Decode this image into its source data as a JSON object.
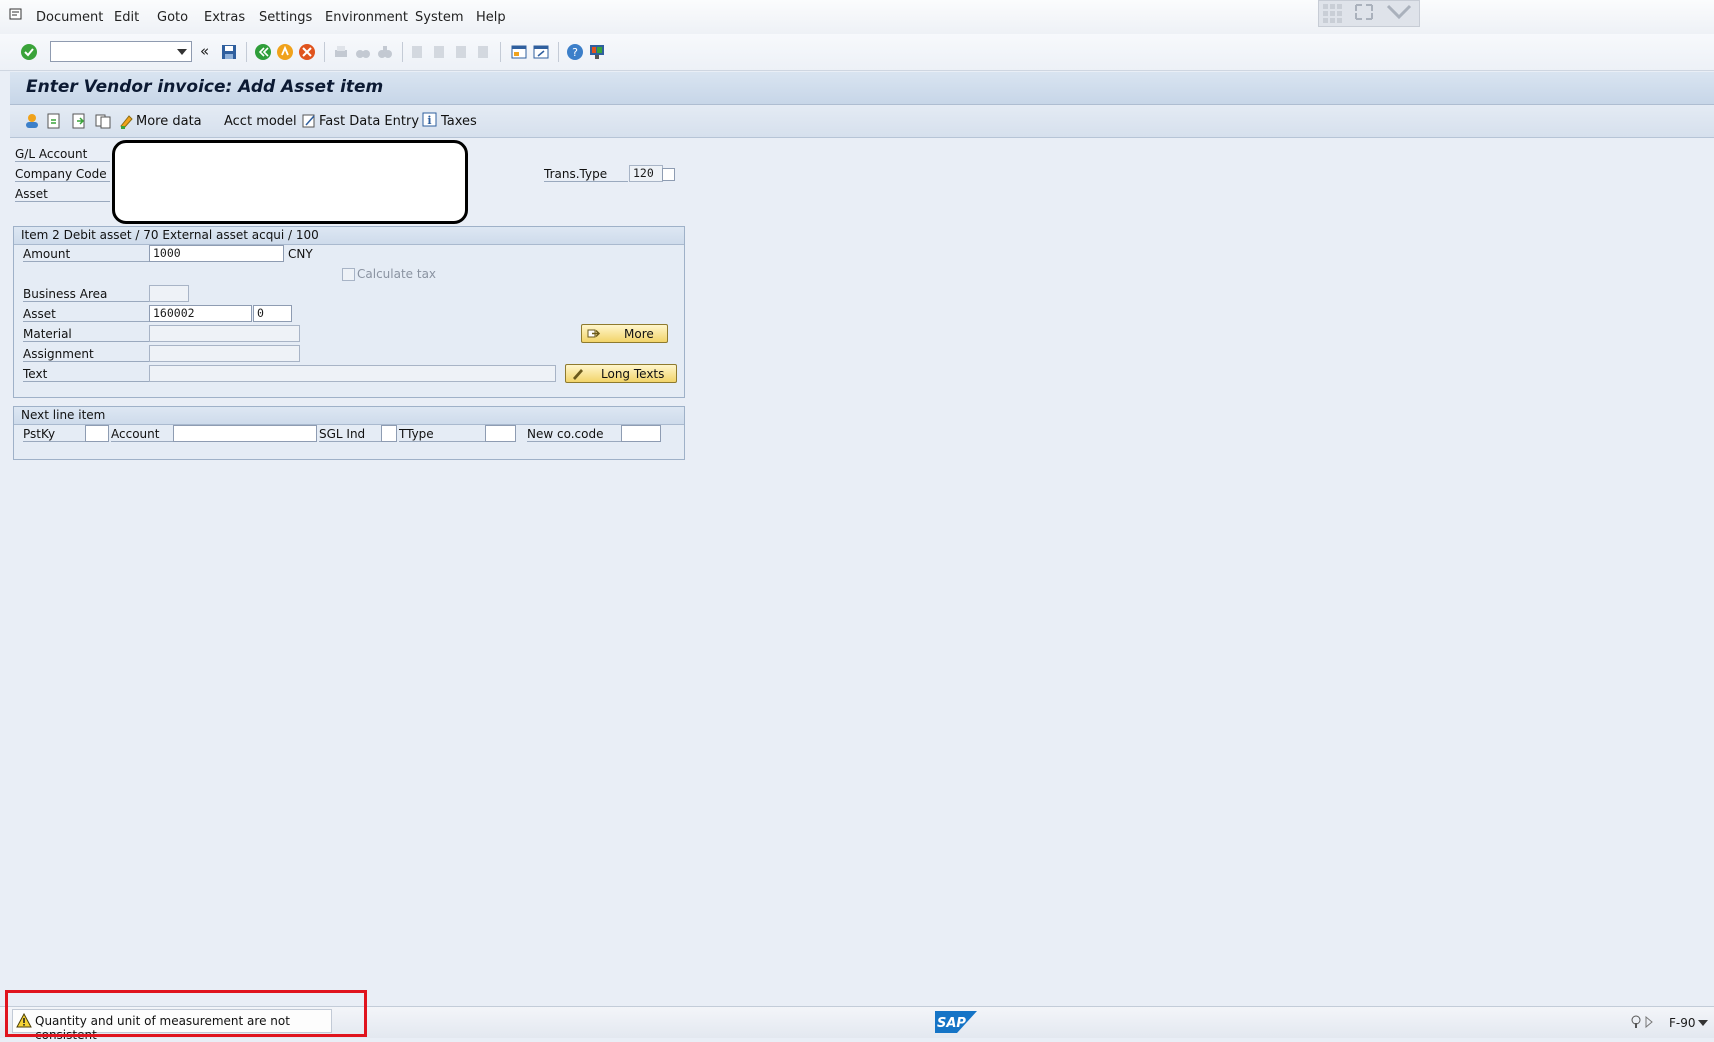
{
  "menu": {
    "items": [
      {
        "label": "Document"
      },
      {
        "label": "Edit"
      },
      {
        "label": "Goto"
      },
      {
        "label": "Extras"
      },
      {
        "label": "Settings"
      },
      {
        "label": "Environment"
      },
      {
        "label": "System"
      },
      {
        "label": "Help"
      }
    ]
  },
  "toolbar": {
    "command_field_value": "",
    "back_nav_symbol": "«"
  },
  "screen": {
    "title": "Enter Vendor invoice: Add Asset item"
  },
  "app_toolbar": {
    "more_data": "More data",
    "acct_model": "Acct model",
    "fast_data_entry": "Fast Data Entry",
    "taxes": "Taxes"
  },
  "header_fields": {
    "gl_account_label": "G/L Account",
    "company_code_label": "Company Code",
    "asset_label": "Asset",
    "trans_type_label": "Trans.Type",
    "trans_type_value": "120"
  },
  "item_group": {
    "title": "Item 2 Debit asset / 70 External asset acqui / 100",
    "amount_label": "Amount",
    "amount_value": "1000",
    "currency": "CNY",
    "calculate_tax_label": "Calculate tax",
    "business_area_label": "Business Area",
    "business_area_value": "",
    "asset_label": "Asset",
    "asset_value": "160002",
    "asset_subnumber": "0",
    "material_label": "Material",
    "material_value": "",
    "assignment_label": "Assignment",
    "assignment_value": "",
    "text_label": "Text",
    "text_value": "",
    "more_button": "More",
    "long_texts_button": "Long Texts"
  },
  "next_line": {
    "title": "Next line item",
    "pstky_label": "PstKy",
    "account_label": "Account",
    "sgl_ind_label": "SGL Ind",
    "ttype_label": "TType",
    "new_cocode_label": "New co.code"
  },
  "status": {
    "message": "Quantity and unit of measurement are not consistent",
    "message_type": "warning",
    "brand": "SAP",
    "transaction": "F-90"
  },
  "colors": {
    "highlight_border": "#e0141e",
    "button_fill": "#f2d46a"
  }
}
